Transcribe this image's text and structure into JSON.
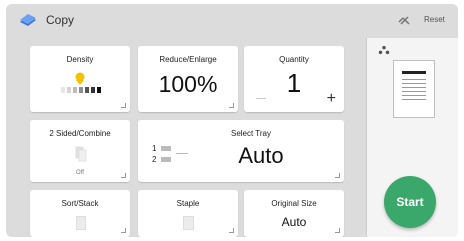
{
  "header": {
    "title": "Copy",
    "reset_label": "Reset",
    "copy_icon": "copy-icon",
    "check_icon": "check-icon"
  },
  "tiles": {
    "density": {
      "label": "Density",
      "level": 0.4
    },
    "reduce_enlarge": {
      "label": "Reduce/Enlarge",
      "value": "100%"
    },
    "quantity": {
      "label": "Quantity",
      "value": "1",
      "plus": "+"
    },
    "two_sided": {
      "label": "2 Sided/Combine",
      "state": "Off"
    },
    "select_tray": {
      "label": "Select Tray",
      "value": "Auto",
      "tray1": "1",
      "tray2": "2"
    },
    "sort_stack": {
      "label": "Sort/Stack"
    },
    "staple": {
      "label": "Staple"
    },
    "original_size": {
      "label": "Original Size",
      "value": "Auto"
    }
  },
  "preview": {
    "stack_icon": "copy-stack-icon"
  },
  "start_button": {
    "label": "Start",
    "color": "#3aa86a"
  }
}
